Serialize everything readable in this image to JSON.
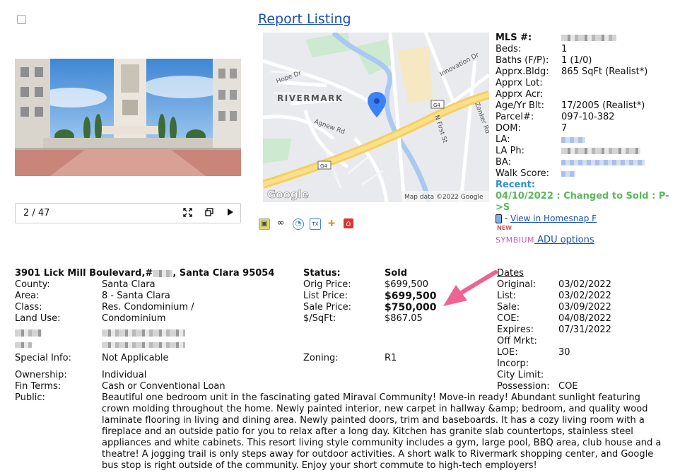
{
  "header": {
    "title": "Report Listing"
  },
  "photo_viewer": {
    "counter": "2 / 47",
    "expand_icon": "expand-icon",
    "window_icon": "window-icon",
    "play_icon": "play-icon"
  },
  "map": {
    "neighborhood": "RIVERMARK",
    "streets": [
      "Hope Dr",
      "Innovation Dr",
      "Zanker Rd",
      "N First St",
      "Agnew Rd"
    ],
    "highway_badges": [
      "G4",
      "G4"
    ],
    "attribution": "Map data ©2022 Google",
    "logo": "Google"
  },
  "facts": {
    "mls_label": "MLS #:",
    "beds_label": "Beds:",
    "beds": "1",
    "baths_label": "Baths (F/P):",
    "baths": "1 (1/0)",
    "bldg_label": "Apprx.Bldg:",
    "bldg": "865 SqFt (Realist*)",
    "lot_label": "Apprx Lot:",
    "acr_label": "Apprx Acr:",
    "age_label": "Age/Yr Blt:",
    "age": "17/2005 (Realist*)",
    "parcel_label": "Parcel#:",
    "parcel": "097-10-382",
    "dom_label": "DOM:",
    "dom": "7",
    "la_label": "LA:",
    "laph_label": "LA Ph:",
    "ba_label": "BA:",
    "walk_label": "Walk Score:",
    "recent_label": "Recent:",
    "recent_value": "04/10/2022 : Changed to Sold : P->S"
  },
  "links": {
    "homesnap_prefix": "-",
    "homesnap_link": "View in Homesnap F",
    "new_tag": "NEW",
    "symbium_brand": "SYMBIUM",
    "adu_link": " ADU options"
  },
  "address": {
    "street": "3901 Lick Mill Boulevard,#",
    "city": ", Santa Clara 95054"
  },
  "details": {
    "county_label": "County:",
    "county": "Santa Clara",
    "area_label": "Area:",
    "area": "8 - Santa Clara",
    "class_label": "Class:",
    "class": "Res. Condominium /",
    "landuse_label": "Land Use:",
    "landuse": "Condominium",
    "special_label": "Special Info:",
    "special": "Not Applicable",
    "ownership_label": "Ownership:",
    "ownership": "Individual",
    "finterms_label": "Fin Terms:",
    "finterms": "Cash or Conventional Loan",
    "public_label": "Public:",
    "public": "Beautiful one bedroom unit in the fascinating gated Miraval Community! Move-in ready! Abundant sunlight featuring crown molding throughout the home. Newly painted interior, new carpet in hallway &amp; bedroom, and quality wood laminate flooring in living and dining area. Newly painted doors, trim and baseboards. It has a cozy living room with a fireplace and an outside patio for you to relax after a long day. Kitchen has granite slab countertops, stainless steel appliances and white cabinets. This resort living style community includes a gym, large pool, BBQ area, club house and a theatre! A jogging trail is only steps away for outdoor activities. A short walk to Rivermark shopping center, and Google bus stop is right outside of the community. Enjoy your short commute to high-tech employers!"
  },
  "pricing": {
    "status_label": "Status:",
    "status": "Sold",
    "orig_label": "Orig Price:",
    "orig": "$699,500",
    "list_label": "List Price:",
    "list": "$699,500",
    "sale_label": "Sale Price:",
    "sale": "$750,000",
    "psf_label": "$/SqFt:",
    "psf": "$867.05",
    "zoning_label": "Zoning:",
    "zoning": "R1"
  },
  "dates": {
    "header": "Dates",
    "original_label": "Original:",
    "original": "03/02/2022",
    "list_label": "List:",
    "list": "03/02/2022",
    "sale_label": "Sale:",
    "sale": "03/09/2022",
    "coe_label": "COE:",
    "coe": "04/08/2022",
    "expires_label": "Expires:",
    "expires": "07/31/2022",
    "offmrkt_label": "Off Mrkt:",
    "loe_label": "LOE:",
    "loe": "30",
    "incorp_label": "Incorp:",
    "citylimit_label": "City Limit:",
    "possession_label": "Possession:",
    "possession": "COE"
  },
  "colors": {
    "link": "#1a4fb4",
    "recent_label": "#2a8fd8",
    "recent_value": "#5cb85c",
    "arrow": "#f06292",
    "symbium": "#c55bb6"
  }
}
